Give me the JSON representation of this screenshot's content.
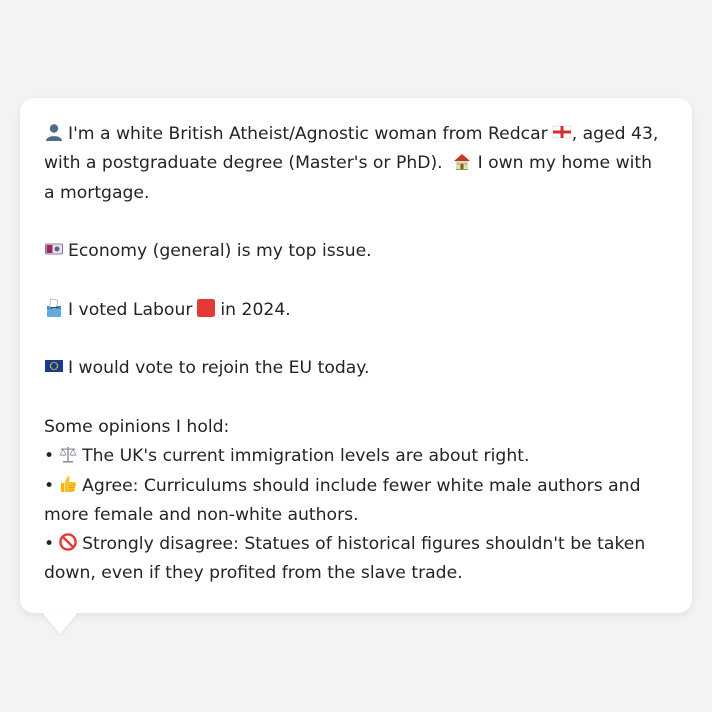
{
  "profile": {
    "line1_pre": "I'm a white British Atheist/Agnostic woman from Redcar",
    "line1_post": ", aged 43, with a postgraduate degree (Master's or PhD).",
    "home_text": "I own my home with a mortgage."
  },
  "issue": {
    "text": "Economy (general) is my top issue."
  },
  "vote": {
    "pre": "I voted Labour",
    "post": "in 2024."
  },
  "eu": {
    "text": "I would vote to rejoin the EU today."
  },
  "opinions": {
    "heading": "Some opinions I hold:",
    "bullet": "•",
    "items": [
      {
        "icon": "balance-scale-icon",
        "text": "The UK's current immigration levels are about right."
      },
      {
        "icon": "thumbs-up-icon",
        "text": "Agree: Curriculums should include fewer white male authors and more female and non-white authors."
      },
      {
        "icon": "prohibited-icon",
        "text": "Strongly disagree: Statues of historical figures shouldn't be taken down, even if they profited from the slave trade."
      }
    ]
  },
  "colors": {
    "page_bg": "#f2f3f5",
    "card_bg": "#ffffff",
    "text": "#222428",
    "labour_red": "#e53935",
    "eu_blue": "#1a3a8f"
  }
}
